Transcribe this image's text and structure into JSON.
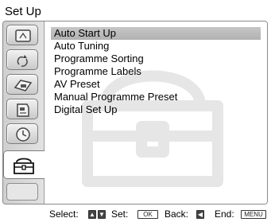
{
  "title": "Set Up",
  "sidebar": {
    "tabs": [
      {
        "icon": "picture-adjustment-icon"
      },
      {
        "icon": "sound-adjustment-icon"
      },
      {
        "icon": "screen-control-icon"
      },
      {
        "icon": "features-icon"
      },
      {
        "icon": "timer-icon"
      },
      {
        "icon": "set-up-toolbox-icon",
        "active": true
      }
    ]
  },
  "menu": {
    "items": [
      {
        "label": "Auto Start Up",
        "selected": true
      },
      {
        "label": "Auto  Tuning"
      },
      {
        "label": "Programme  Sorting"
      },
      {
        "label": "Programme  Labels"
      },
      {
        "label": "AV  Preset"
      },
      {
        "label": "Manual  Programme  Preset"
      },
      {
        "label": "Digital Set Up"
      }
    ]
  },
  "footer": {
    "select_label": "Select:",
    "set_label": "Set:",
    "set_key": "OK",
    "back_label": "Back:",
    "end_label": "End:",
    "end_key": "MENU"
  }
}
